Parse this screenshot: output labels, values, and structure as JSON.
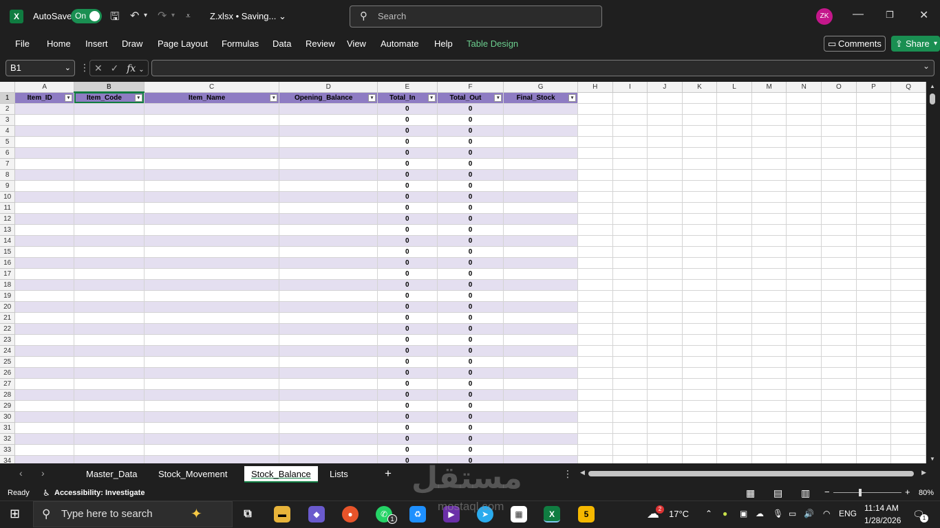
{
  "titlebar": {
    "autosave_label": "AutoSave",
    "autosave_state": "On",
    "filename": "Z.xlsx",
    "save_status": "Saving...",
    "search_placeholder": "Search",
    "avatar_initials": "ZK"
  },
  "menu": {
    "items": [
      "File",
      "Home",
      "Insert",
      "Draw",
      "Page Layout",
      "Formulas",
      "Data",
      "Review",
      "View",
      "Automate",
      "Help",
      "Table Design"
    ],
    "comments_label": "Comments",
    "share_label": "Share"
  },
  "formula_bar": {
    "name_box": "B1",
    "fx_label": "fx",
    "formula": ""
  },
  "grid": {
    "columns": [
      "A",
      "B",
      "C",
      "D",
      "E",
      "F",
      "G",
      "H",
      "I",
      "J",
      "K",
      "L",
      "M",
      "N",
      "O",
      "P",
      "Q"
    ],
    "selected_column": "B",
    "selected_row": 1,
    "table_headers": [
      "Item_ID",
      "Item_Code",
      "Item_Name",
      "Opening_Balance",
      "Total_In",
      "Total_Out",
      "Final_Stock"
    ],
    "first_row": 1,
    "last_row": 34,
    "total_in_value": "0",
    "total_out_value": "0"
  },
  "sheets": {
    "tabs": [
      "Master_Data",
      "Stock_Movement",
      "Stock_Balance",
      "Lists"
    ],
    "active": "Stock_Balance"
  },
  "status": {
    "ready": "Ready",
    "accessibility": "Accessibility: Investigate",
    "zoom": "80%"
  },
  "taskbar": {
    "search_placeholder": "Type here to search",
    "weather_badge": "2",
    "temperature": "17°C",
    "language": "ENG",
    "time": "11:14 AM",
    "date": "1/28/2026",
    "notification_count": "1",
    "whatsapp_badge": "1"
  },
  "watermark": {
    "arabic": "مستقل",
    "latin": "mostaql.com"
  },
  "colors": {
    "excel_green": "#107c41",
    "table_header_purple": "#8e7cc3",
    "table_band_lavender": "#e4dff0"
  }
}
